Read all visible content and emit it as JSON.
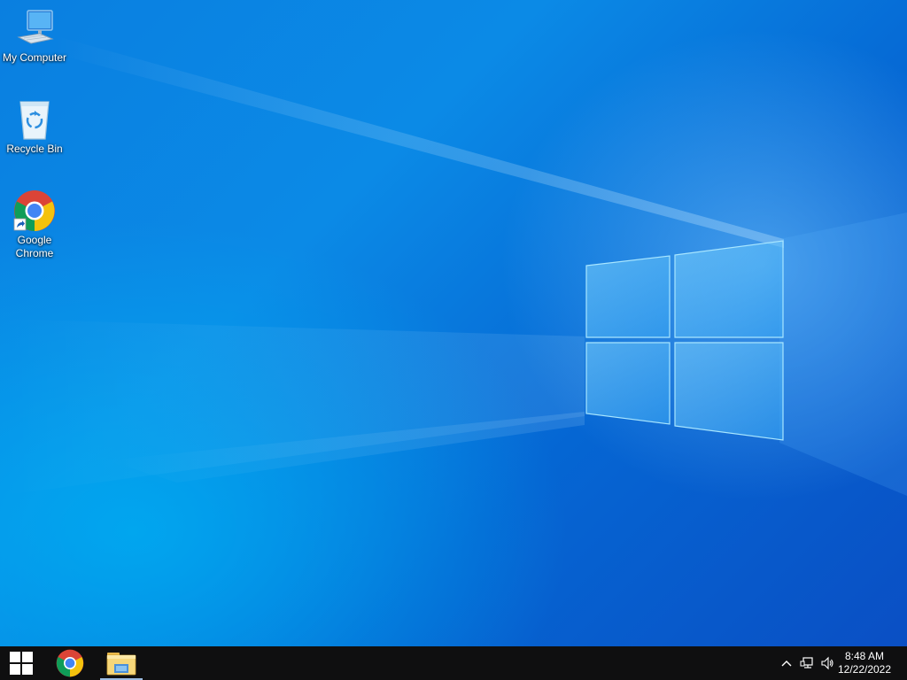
{
  "desktop": {
    "icons": [
      {
        "label": "My Computer",
        "icon": "monitor-computer-icon"
      },
      {
        "label": "Recycle Bin",
        "icon": "recycle-bin-icon"
      },
      {
        "label": "Google\nChrome",
        "icon": "chrome-icon"
      }
    ]
  },
  "taskbar": {
    "start_icon": "windows-logo-icon",
    "pinned": [
      {
        "name": "Google Chrome",
        "icon": "chrome-icon"
      },
      {
        "name": "File Explorer",
        "icon": "folder-icon"
      }
    ],
    "tray": {
      "icons": [
        "chevron-up-icon",
        "network-icon",
        "volume-icon"
      ],
      "time": "8:48 AM",
      "date": "12/22/2022"
    }
  },
  "colors": {
    "taskbar": "#0f0f10",
    "desktop_blue": "#0a7fe0",
    "chrome_red": "#db4437",
    "chrome_yellow": "#f4c20d",
    "chrome_green": "#0f9d58",
    "chrome_blue": "#4285f4"
  }
}
